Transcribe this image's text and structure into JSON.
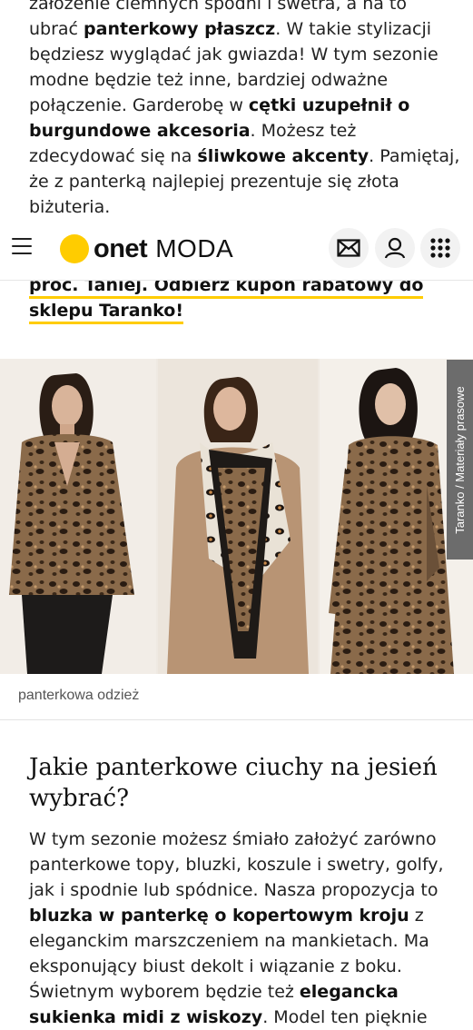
{
  "article": {
    "intro_paragraph": [
      {
        "t": "założenie ciemnych spodni i swetra, a na to ubrać ",
        "b": false
      },
      {
        "t": "panterkowy płaszcz",
        "b": true
      },
      {
        "t": ". W takie stylizacji będziesz wyglądać jak gwiazda! W tym sezonie modne będzie też inne, bardziej odważne połączenie. Garderobę w ",
        "b": false
      },
      {
        "t": "cętki uzupełnił o burgundowe akcesoria",
        "b": true
      },
      {
        "t": ". Możesz też zdecydować się na ",
        "b": false
      },
      {
        "t": "śliwkowe akcenty",
        "b": true
      },
      {
        "t": ". Pamiętaj, że z panterką najlepiej prezentuje się złota biżuteria.",
        "b": false
      }
    ],
    "coupon_text": "proc. Taniej. Odbierz kupon rabatowy do sklepu Taranko!",
    "image_credit": "Taranko / Materiały prasowe",
    "image_caption": "panterkowa odzież",
    "section_heading": "Jakie panterkowe ciuchy na jesień wybrać?",
    "body_paragraph": [
      {
        "t": "W tym sezonie możesz śmiało założyć zarówno panterkowe topy, bluzki, koszule i swetry, golfy, jak i spodnie lub spódnice. Nasza propozycja to ",
        "b": false
      },
      {
        "t": "bluzka w panterkę o kopertowym kroju",
        "b": true
      },
      {
        "t": " z eleganckim marszczeniem na mankietach. Ma eksponujący biust dekolt i wiązanie z boku. Świetnym wyborem będzie też ",
        "b": false
      },
      {
        "t": "elegancka sukienka midi z wiskozy",
        "b": true
      },
      {
        "t": ". Model ten pięknie",
        "b": false
      }
    ]
  },
  "header": {
    "logo_brand": "onet",
    "logo_section": "MODA",
    "accent_color": "#ffcc00",
    "icons": [
      "menu-icon",
      "mail-icon",
      "user-icon",
      "apps-grid-icon"
    ]
  }
}
